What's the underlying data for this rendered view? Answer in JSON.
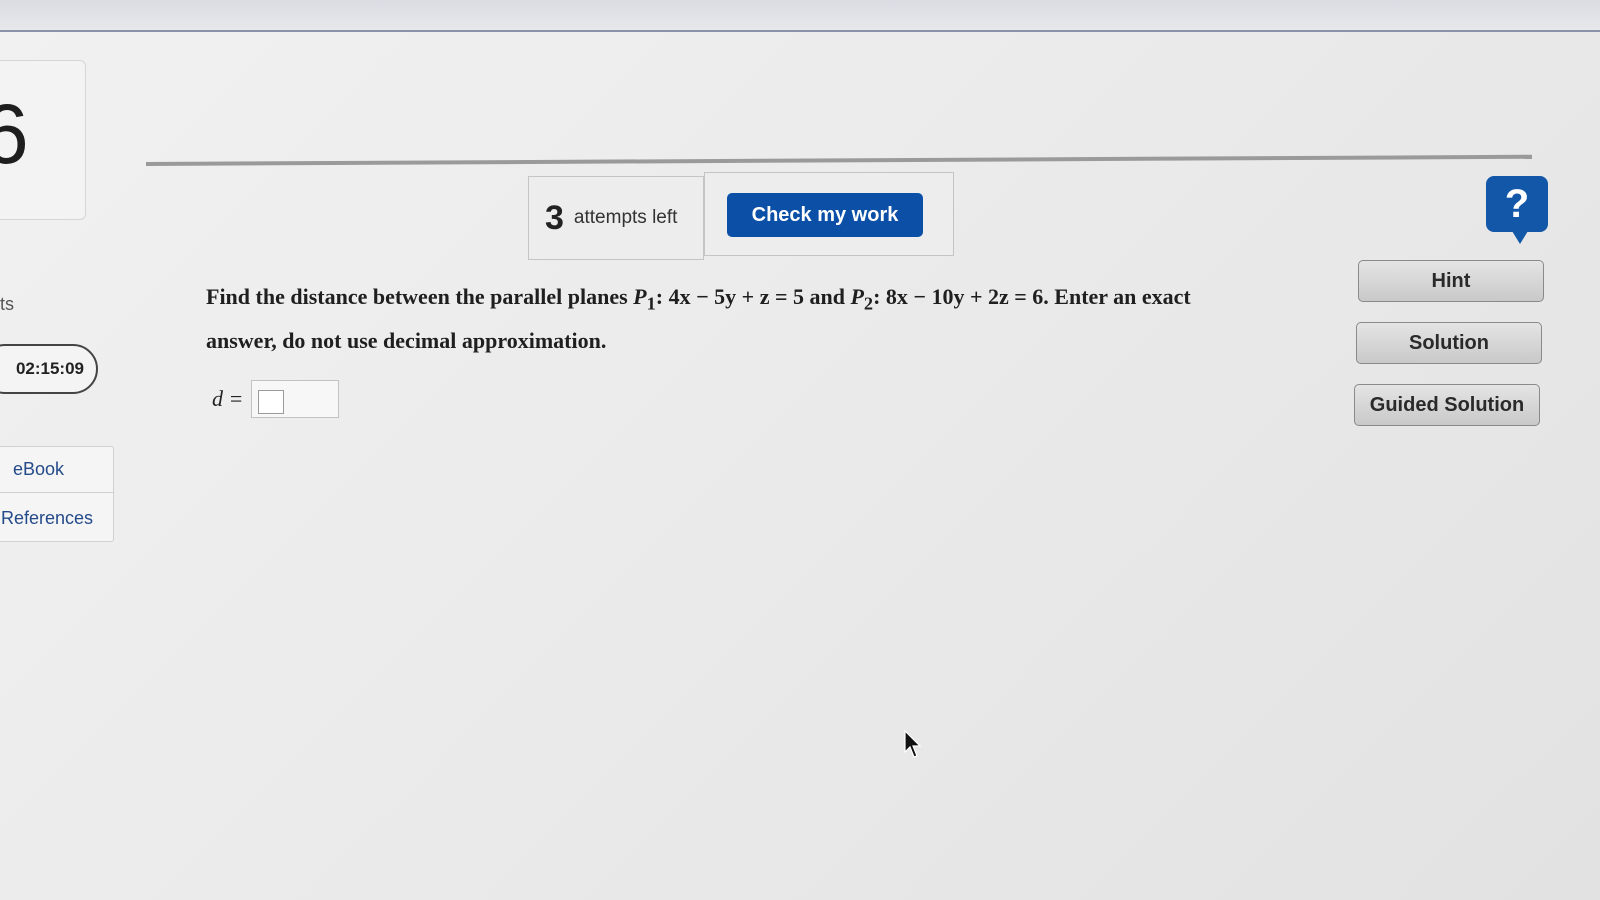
{
  "question_number": "6",
  "side_label": "ts",
  "timer": "02:15:09",
  "references_panel": {
    "ebook_label": "eBook",
    "references_label": "References"
  },
  "attempts": {
    "count": "3",
    "label": "attempts left"
  },
  "check_button_label": "Check my work",
  "help_icon_glyph": "?",
  "question": {
    "text_part1": "Find the distance between the parallel planes ",
    "p1_label": "P",
    "p1_sub": "1",
    "p1_eq": ": 4x − 5y + z = 5 and ",
    "p2_label": "P",
    "p2_sub": "2",
    "p2_eq": ": 8x − 10y + 2z = 6. Enter an exact answer, do not use decimal approximation."
  },
  "answer": {
    "label": "d =",
    "value": ""
  },
  "side_buttons": {
    "hint": "Hint",
    "solution": "Solution",
    "guided_solution": "Guided Solution"
  },
  "colors": {
    "primary_blue": "#0b4fa6",
    "help_blue": "#1257a8",
    "link_blue": "#244a8a"
  }
}
